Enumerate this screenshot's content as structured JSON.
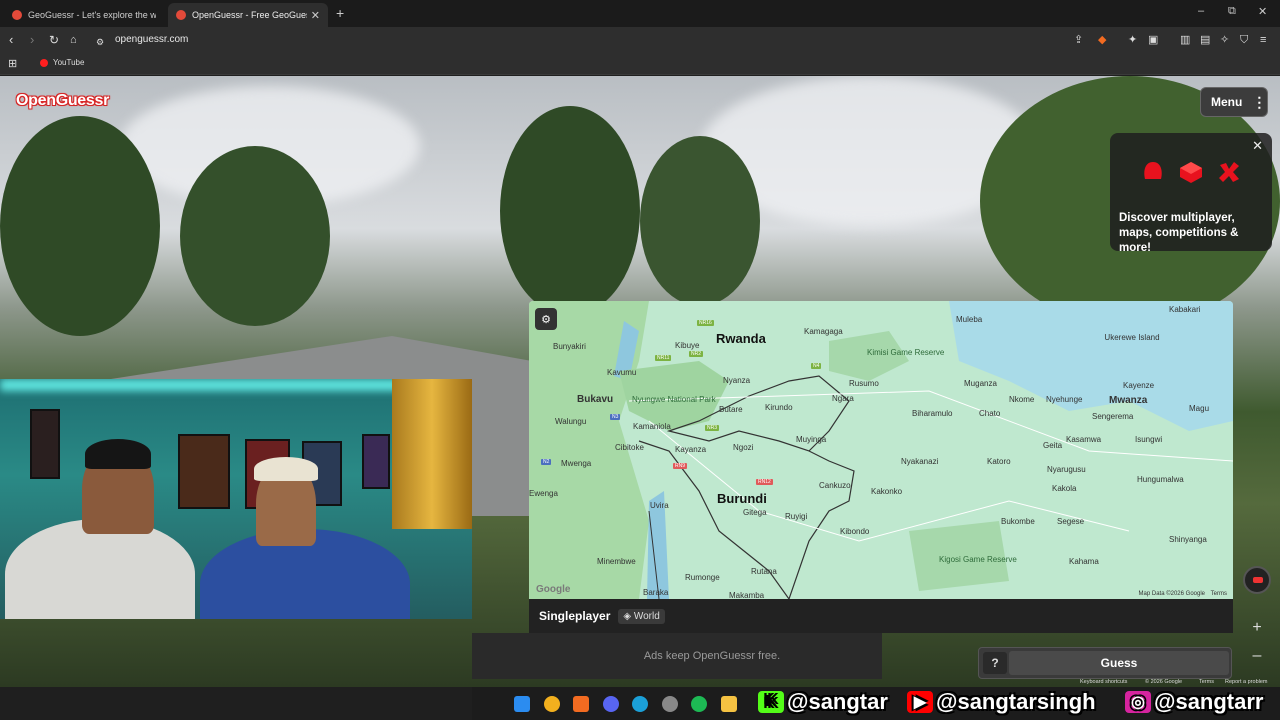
{
  "browser": {
    "tabs": [
      {
        "title": "GeoGuessr - Let's explore the world!",
        "active": false
      },
      {
        "title": "OpenGuessr - Free GeoGuess",
        "active": true
      }
    ],
    "new_tab": "+",
    "window_controls": {
      "minimize": "–",
      "restore": "⧉",
      "close": "✕"
    },
    "url": "openguessr.com",
    "bookmarks": [
      {
        "label": "YouTube"
      }
    ]
  },
  "game": {
    "logo": "OpenGuessr",
    "menu_label": "Menu",
    "promo": {
      "text": "Discover multiplayer, maps, competitions & more!"
    },
    "map": {
      "countries": [
        "Rwanda",
        "Burundi"
      ],
      "places": [
        "Kabakari",
        "Muleba",
        "Ukerewe Island",
        "Kayenze",
        "Mwanza",
        "Magu",
        "Muganza",
        "Nkome",
        "Nyehunge",
        "Sengerema",
        "Kamagaga",
        "Kimisi Game Reserve",
        "Rusumo",
        "Ngara",
        "Biharamulo",
        "Chato",
        "Kibuye",
        "Nyanza",
        "Kirundo",
        "Butare",
        "Bunyakiri",
        "Kavumu",
        "Bukavu",
        "Walungu",
        "Kamaniola",
        "Nyungwe National Park",
        "Cibitoke",
        "Ngozi",
        "Muyinga",
        "Mwenga",
        "Kayanza",
        "Kakonko",
        "Nyakanazi",
        "Katoro",
        "Geita",
        "Kasamwa",
        "Nyarugusu",
        "Isungwi",
        "Kakola",
        "Hungumalwa",
        "Bukombe",
        "Segese",
        "Uvira",
        "Gitega",
        "Cankuzo",
        "Ruyigi",
        "Kibondo",
        "Kigosi Game Reserve",
        "Shinyanga",
        "Kahama",
        "Minembwe",
        "Rumonge",
        "Rutana",
        "Baraka",
        "Makamba",
        "Ewenga"
      ],
      "roads": [
        "NR16",
        "NR2",
        "NR11",
        "N4",
        "N3",
        "NR3",
        "N2",
        "RN9",
        "RN12"
      ],
      "attribution": "Map Data ©2026 Google",
      "terms": "Terms",
      "google": "Google"
    },
    "mode": "Singleplayer",
    "map_name": "World",
    "ads_text": "Ads keep OpenGuessr free.",
    "help_label": "?",
    "guess_label": "Guess",
    "zoom_in": "+",
    "zoom_out": "–",
    "footer": {
      "shortcuts": "Keyboard shortcuts",
      "copyright": "© 2026 Google",
      "terms": "Terms",
      "report": "Report a problem"
    }
  },
  "overlay": {
    "kick": "@sangtar",
    "youtube": "@sangtarsingh",
    "instagram": "@sangtarr"
  }
}
